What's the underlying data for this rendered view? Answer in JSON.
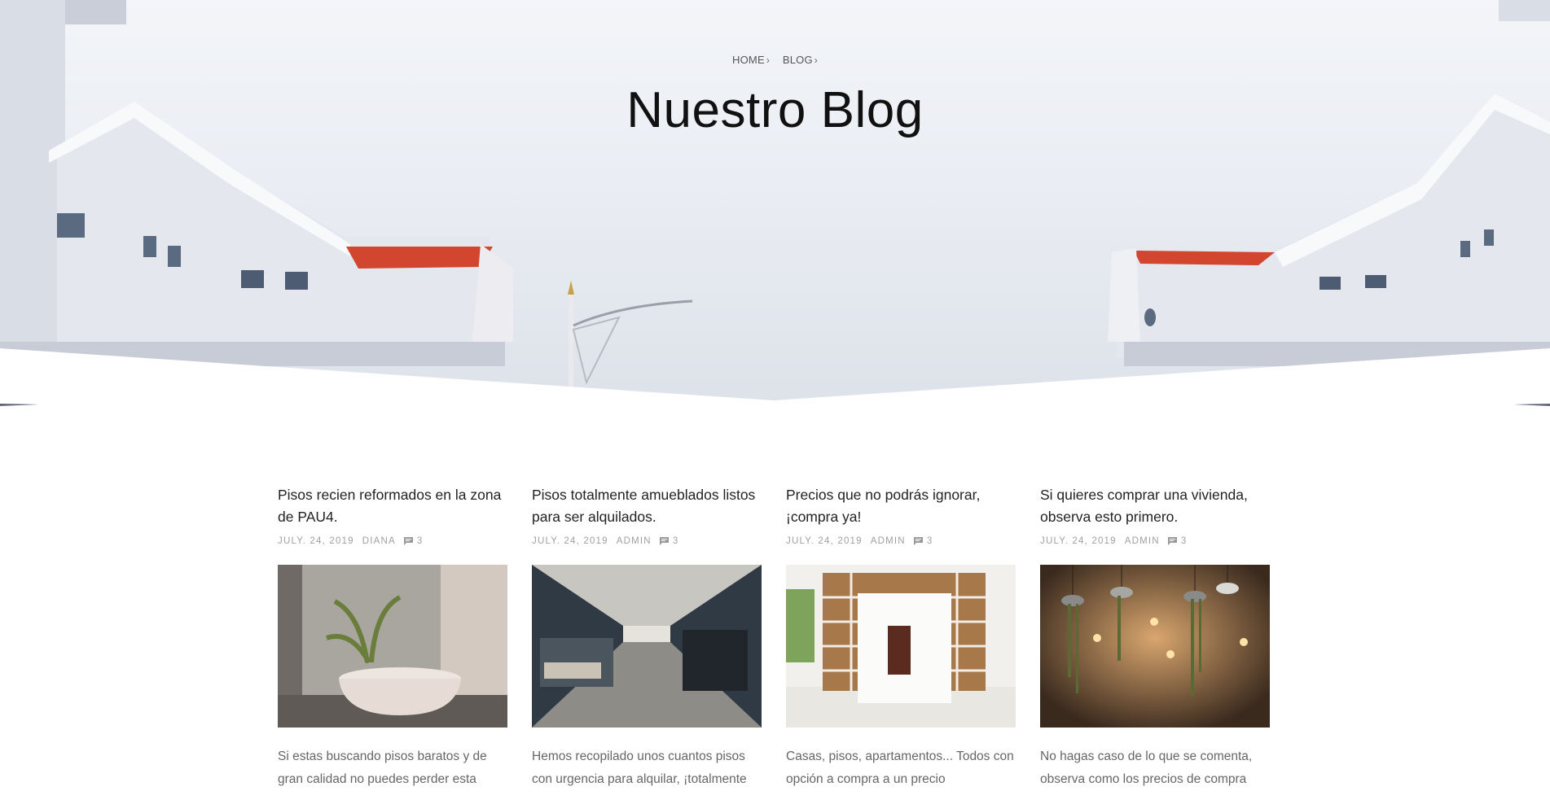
{
  "hero": {
    "breadcrumb": [
      {
        "label": "HOME"
      },
      {
        "label": "BLOG"
      }
    ],
    "title": "Nuestro Blog"
  },
  "posts": [
    {
      "title": "Pisos recien reformados en la zona de PAU4.",
      "date": "JULY. 24, 2019",
      "author": "DIANA",
      "comments": "3",
      "image": "bathroom-photo",
      "excerpt": "Si estas buscando pisos baratos y de gran calidad no puedes perder esta"
    },
    {
      "title": "Pisos totalmente amueblados listos para ser alquilados.",
      "date": "JULY. 24, 2019",
      "author": "ADMIN",
      "comments": "3",
      "image": "office-hallway-photo",
      "excerpt": "Hemos recopilado unos cuantos pisos con urgencia para alquilar, ¡totalmente"
    },
    {
      "title": "Precios que no podrás ignorar, ¡compra ya!",
      "date": "JULY. 24, 2019",
      "author": "ADMIN",
      "comments": "3",
      "image": "shelving-room-photo",
      "excerpt": "Casas, pisos, apartamentos... Todos con opción a compra a un precio"
    },
    {
      "title": "Si quieres comprar una vivienda, observa esto primero.",
      "date": "JULY. 24, 2019",
      "author": "ADMIN",
      "comments": "3",
      "image": "hanging-plants-photo",
      "excerpt": "No hagas caso de lo que se comenta, observa como los precios de compra"
    }
  ]
}
